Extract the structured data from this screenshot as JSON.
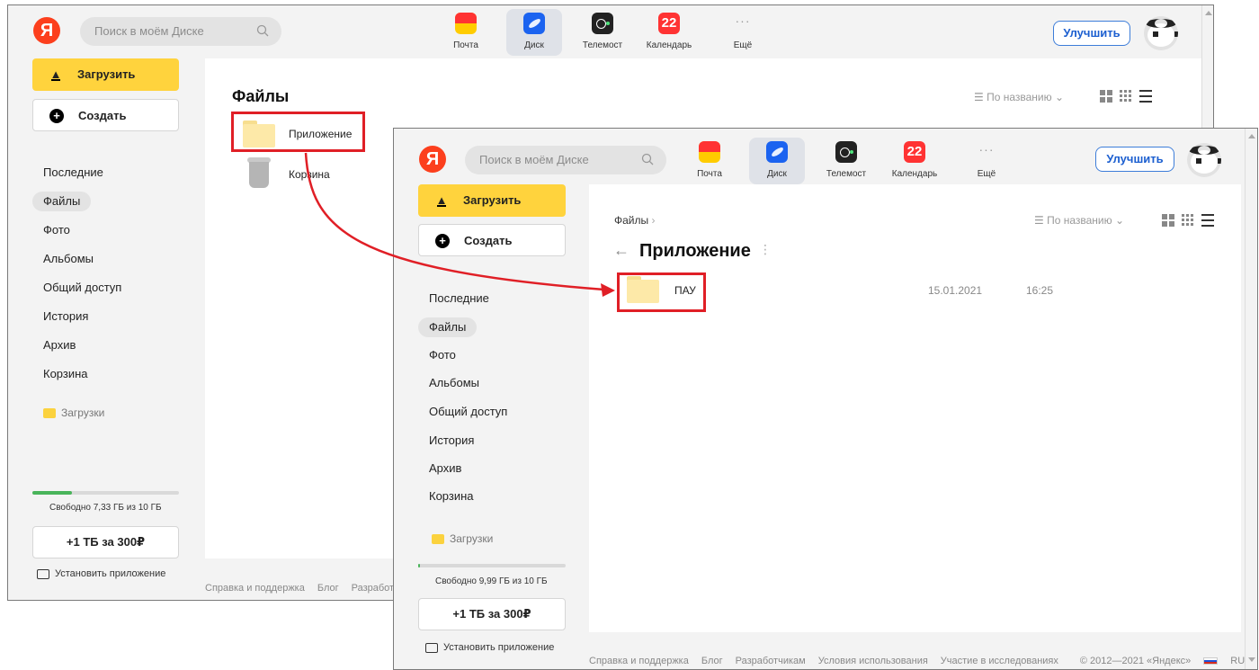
{
  "header": {
    "search_placeholder": "Поиск в моём Диске",
    "apps": [
      {
        "label": "Почта",
        "icon": "mail-icon"
      },
      {
        "label": "Диск",
        "icon": "disk-icon"
      },
      {
        "label": "Телемост",
        "icon": "telemost-icon"
      },
      {
        "label": "Календарь",
        "icon": "calendar-icon",
        "badge": "22"
      },
      {
        "label": "Ещё",
        "icon": "more-icon",
        "glyph": "···"
      }
    ],
    "upgrade_label": "Улучшить",
    "logo_letter": "Я"
  },
  "sidebar": {
    "upload_label": "Загрузить",
    "create_label": "Создать",
    "nav": [
      "Последние",
      "Файлы",
      "Фото",
      "Альбомы",
      "Общий доступ",
      "История",
      "Архив",
      "Корзина"
    ],
    "downloads_label": "Загрузки",
    "tb_offer": "+1 ТБ за 300₽",
    "install_label": "Установить приложение"
  },
  "window1": {
    "title": "Файлы",
    "sort_label": "По названию",
    "files": [
      {
        "name": "Приложение",
        "icon": "folder-icon"
      },
      {
        "name": "Корзина",
        "icon": "trash-icon"
      }
    ],
    "quota_text": "Свободно 7,33 ГБ из 10 ГБ",
    "quota_used_fraction": 0.27,
    "footer_links": [
      "Справка и поддержка",
      "Блог",
      "Разработч"
    ]
  },
  "window2": {
    "breadcrumb": "Файлы",
    "breadcrumb_sep": "›",
    "back_arrow": "←",
    "title": "Приложение",
    "sort_label": "По названию",
    "files": [
      {
        "name": "ПАУ",
        "date": "15.01.2021",
        "time": "16:25",
        "icon": "folder-icon"
      }
    ],
    "quota_text": "Свободно 9,99 ГБ из 10 ГБ",
    "quota_used_fraction": 0.002,
    "footer_links": [
      "Справка и поддержка",
      "Блог",
      "Разработчикам",
      "Условия использования",
      "Участие в исследованиях"
    ],
    "copyright": "© 2012—2021 «Яндекс»",
    "lang": "RU"
  },
  "colors": {
    "highlight": "#e01f26",
    "upload_button": "#ffd33d",
    "accent_blue": "#1c5fd0",
    "quota_fill": "#49b45a",
    "folder": "#fde9a8"
  }
}
